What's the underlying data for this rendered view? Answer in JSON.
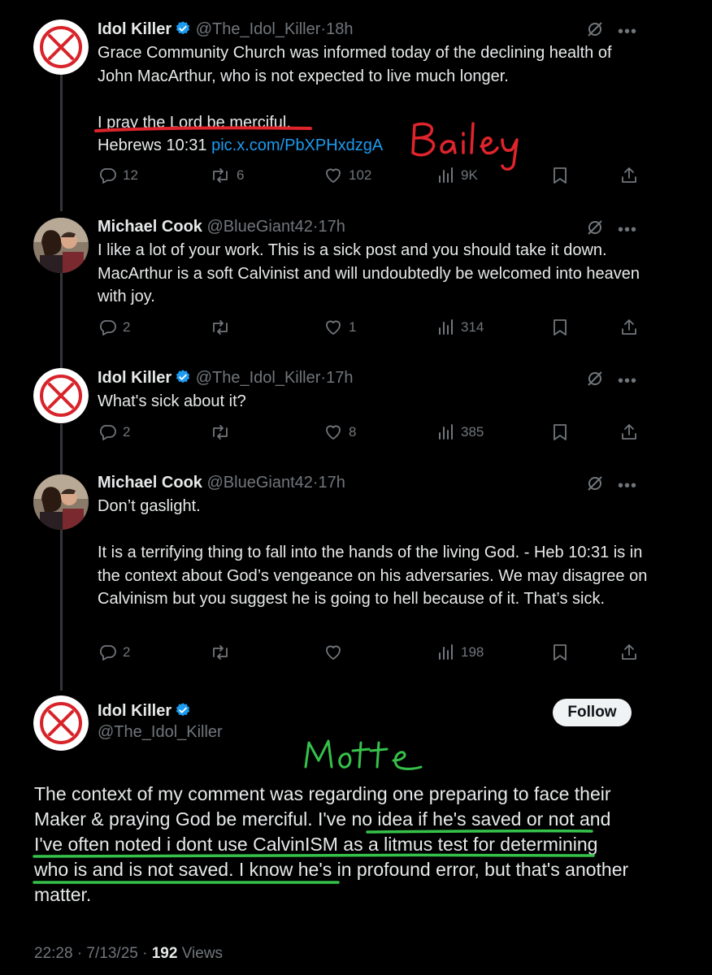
{
  "colors": {
    "accent": "#1d9bf0",
    "annotation_red": "#e0242c",
    "annotation_green": "#36c24a"
  },
  "posts": [
    {
      "name": "Idol Killer",
      "verified": true,
      "handle": "@The_Idol_Killer",
      "sep": "·",
      "time": "18h",
      "avatar": "red-x-circle",
      "text1": "Grace Community Church was informed today of the declining health of John MacArthur, who is not expected to live much longer.",
      "text2": "I pray the Lord be merciful.",
      "text3": "Hebrews 10:31 ",
      "link": "pic.x.com/PbXPHxdzgA",
      "replies": "12",
      "reposts": "6",
      "likes": "102",
      "views": "9K"
    },
    {
      "name": "Michael Cook",
      "verified": false,
      "handle": "@BlueGiant42",
      "sep": "·",
      "time": "17h",
      "avatar": "couple-photo",
      "text": "I like a lot of your work. This is a sick post and you should take it down. MacArthur is a soft Calvinist and will undoubtedly be welcomed into heaven with joy.",
      "replies": "2",
      "reposts": "",
      "likes": "1",
      "views": "314"
    },
    {
      "name": "Idol Killer",
      "verified": true,
      "handle": "@The_Idol_Killer",
      "sep": "·",
      "time": "17h",
      "avatar": "red-x-circle",
      "text": "What's sick about it?",
      "replies": "2",
      "reposts": "",
      "likes": "8",
      "views": "385"
    },
    {
      "name": "Michael Cook",
      "verified": false,
      "handle": "@BlueGiant42",
      "sep": "·",
      "time": "17h",
      "avatar": "couple-photo",
      "text": "Don’t gaslight.\n\nIt is a terrifying thing to fall into the hands of the living God. - Heb 10:31 is in the context about God’s vengeance on his adversaries. We may disagree on Calvinism but you suggest he is going to hell because of it. That’s sick.",
      "replies": "2",
      "reposts": "",
      "likes": "",
      "views": "198"
    }
  ],
  "main_post": {
    "name": "Idol Killer",
    "verified": true,
    "handle": "@The_Idol_Killer",
    "follow_label": "Follow",
    "text_a": "The context of my comment was regarding one preparing to face their Maker & praying God be merciful. ",
    "text_b": "I've no idea if he's saved or not and I've often noted i dont use CalvinISM as a litmus test for determining who is and is not saved",
    "text_c": ". I know he's in profound error, but that's another matter.",
    "time": "22:28 · 7/13/25 · ",
    "views_count": "192",
    "views_label": " Views"
  },
  "annotations": {
    "red_word": "Bailey",
    "green_word": "Motte"
  }
}
